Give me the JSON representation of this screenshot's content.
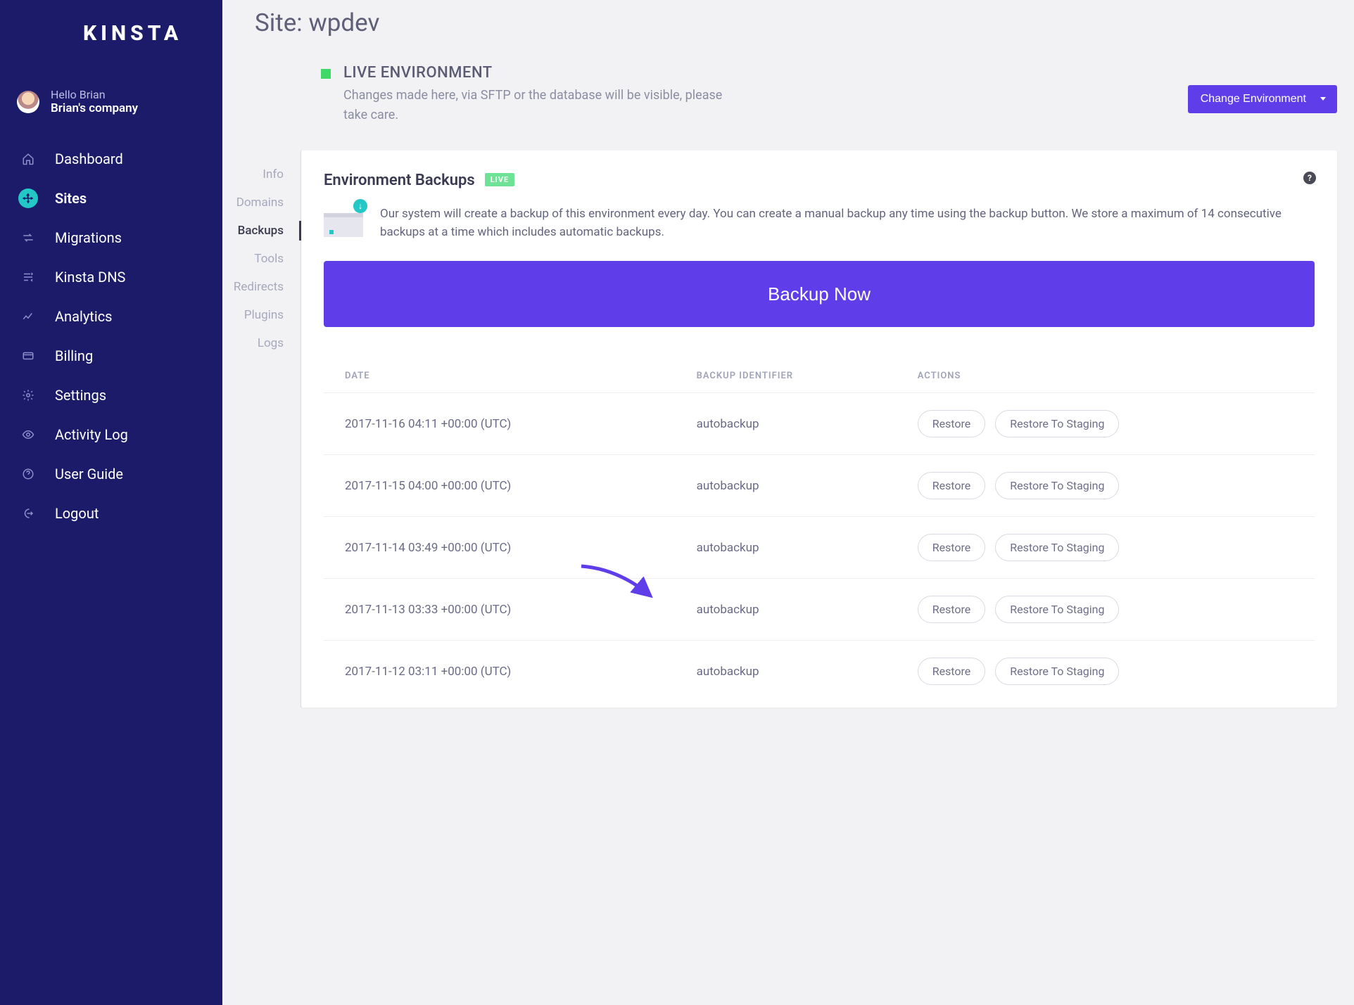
{
  "brand": "KINSTA",
  "user": {
    "hello": "Hello Brian",
    "company": "Brian's company"
  },
  "nav": {
    "dashboard": "Dashboard",
    "sites": "Sites",
    "migrations": "Migrations",
    "dns": "Kinsta DNS",
    "analytics": "Analytics",
    "billing": "Billing",
    "settings": "Settings",
    "activity": "Activity Log",
    "userguide": "User Guide",
    "logout": "Logout"
  },
  "page": {
    "title": "Site: wpdev"
  },
  "environment": {
    "heading": "LIVE ENVIRONMENT",
    "description": "Changes made here, via SFTP or the database will be visible, please take care.",
    "change_btn": "Change Environment"
  },
  "subnav": {
    "info": "Info",
    "domains": "Domains",
    "backups": "Backups",
    "tools": "Tools",
    "redirects": "Redirects",
    "plugins": "Plugins",
    "logs": "Logs"
  },
  "card": {
    "title": "Environment Backups",
    "badge": "LIVE",
    "help": "?",
    "description": "Our system will create a backup of this environment every day. You can create a manual backup any time using the backup button. We store a maximum of 14 consecutive backups at a time which includes automatic backups.",
    "backup_now": "Backup Now"
  },
  "table": {
    "cols": {
      "date": "DATE",
      "id": "BACKUP IDENTIFIER",
      "actions": "ACTIONS"
    },
    "restore": "Restore",
    "restore_staging": "Restore To Staging",
    "rows": [
      {
        "date": "2017-11-16 04:11 +00:00 (UTC)",
        "id": "autobackup"
      },
      {
        "date": "2017-11-15 04:00 +00:00 (UTC)",
        "id": "autobackup"
      },
      {
        "date": "2017-11-14 03:49 +00:00 (UTC)",
        "id": "autobackup"
      },
      {
        "date": "2017-11-13 03:33 +00:00 (UTC)",
        "id": "autobackup"
      },
      {
        "date": "2017-11-12 03:11 +00:00 (UTC)",
        "id": "autobackup"
      }
    ]
  },
  "colors": {
    "navy": "#1b1b69",
    "purple": "#5f3ee9",
    "teal": "#22c7c6",
    "green": "#40d968"
  }
}
